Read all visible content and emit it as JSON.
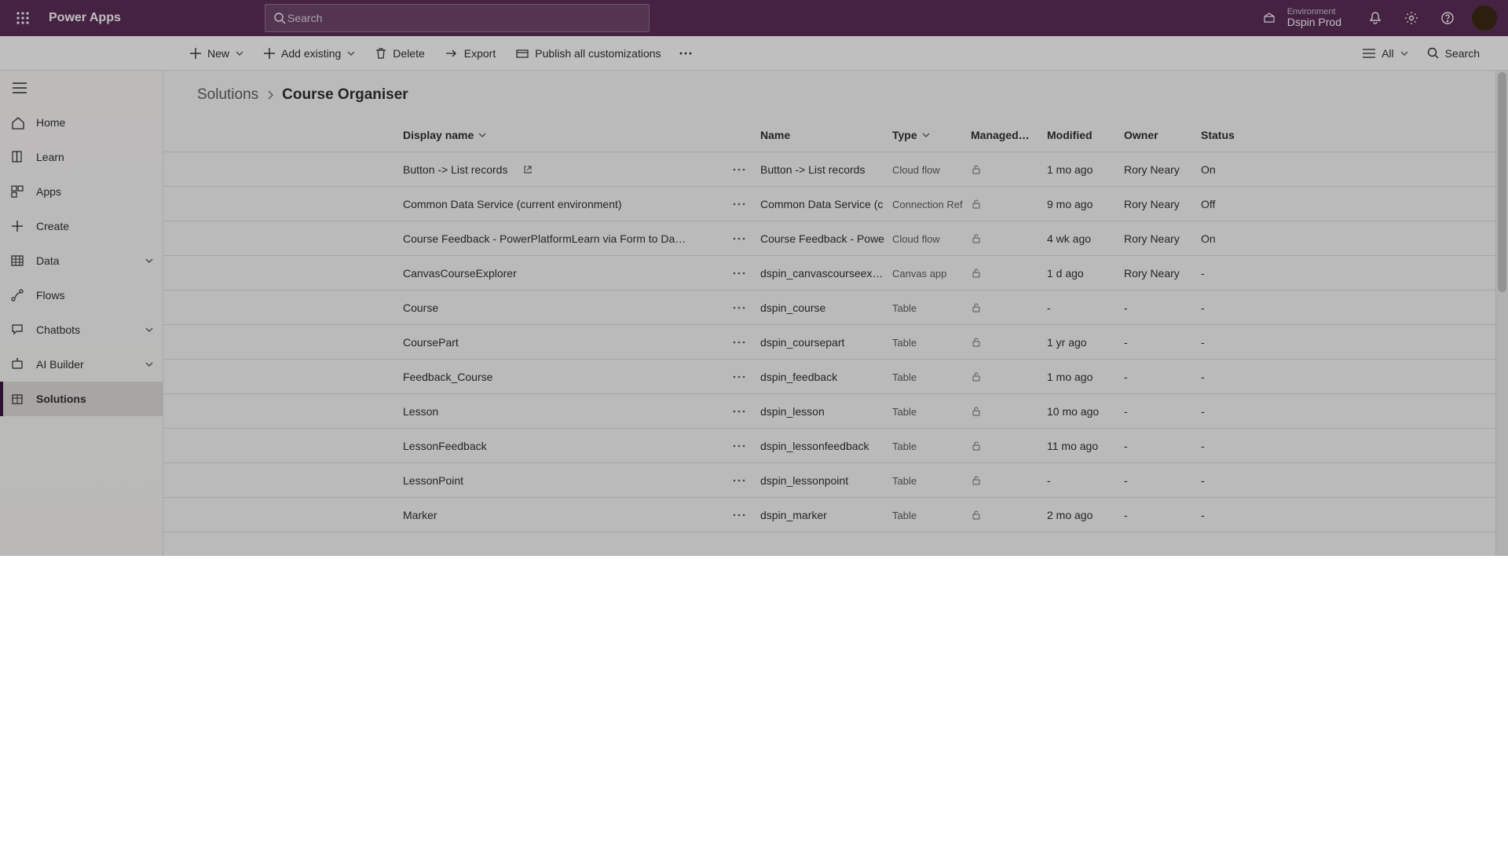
{
  "brand": "Power Apps",
  "search_placeholder": "Search",
  "environment": {
    "label": "Environment",
    "name": "Dspin Prod"
  },
  "cmdbar": {
    "new": "New",
    "add_existing": "Add existing",
    "delete": "Delete",
    "export": "Export",
    "publish": "Publish all customizations",
    "filter_all": "All",
    "search": "Search"
  },
  "sidebar": {
    "items": [
      {
        "label": "Home",
        "icon": "home"
      },
      {
        "label": "Learn",
        "icon": "book"
      },
      {
        "label": "Apps",
        "icon": "apps"
      },
      {
        "label": "Create",
        "icon": "plus"
      },
      {
        "label": "Data",
        "icon": "grid",
        "expandable": true
      },
      {
        "label": "Flows",
        "icon": "flow"
      },
      {
        "label": "Chatbots",
        "icon": "chat",
        "expandable": true
      },
      {
        "label": "AI Builder",
        "icon": "ai",
        "expandable": true
      },
      {
        "label": "Solutions",
        "icon": "package",
        "active": true
      }
    ]
  },
  "breadcrumbs": {
    "root": "Solutions",
    "current": "Course Organiser"
  },
  "columns": {
    "display_name": "Display name",
    "name": "Name",
    "type": "Type",
    "managed": "Managed…",
    "modified": "Modified",
    "owner": "Owner",
    "status": "Status"
  },
  "rows": [
    {
      "display": "Button -> List records",
      "ext": true,
      "name": "Button -> List records",
      "type": "Cloud flow",
      "managed": "lock",
      "modified": "1 mo ago",
      "owner": "Rory Neary",
      "status": "On"
    },
    {
      "display": "Common Data Service (current environment)",
      "name": "Common Data Service (c",
      "type": "Connection Ref",
      "managed": "lock",
      "modified": "9 mo ago",
      "owner": "Rory Neary",
      "status": "Off"
    },
    {
      "display": "Course Feedback - PowerPlatformLearn via Form to Da…",
      "name": "Course Feedback - Powe",
      "type": "Cloud flow",
      "managed": "lock",
      "modified": "4 wk ago",
      "owner": "Rory Neary",
      "status": "On"
    },
    {
      "display": "CanvasCourseExplorer",
      "name": "dspin_canvascourseexplo",
      "type": "Canvas app",
      "managed": "lock",
      "modified": "1 d ago",
      "owner": "Rory Neary",
      "status": "-"
    },
    {
      "display": "Course",
      "name": "dspin_course",
      "type": "Table",
      "managed": "lock",
      "modified": "-",
      "owner": "-",
      "status": "-"
    },
    {
      "display": "CoursePart",
      "name": "dspin_coursepart",
      "type": "Table",
      "managed": "lock",
      "modified": "1 yr ago",
      "owner": "-",
      "status": "-"
    },
    {
      "display": "Feedback_Course",
      "name": "dspin_feedback",
      "type": "Table",
      "managed": "lock",
      "modified": "1 mo ago",
      "owner": "-",
      "status": "-"
    },
    {
      "display": "Lesson",
      "name": "dspin_lesson",
      "type": "Table",
      "managed": "lock",
      "modified": "10 mo ago",
      "owner": "-",
      "status": "-"
    },
    {
      "display": "LessonFeedback",
      "name": "dspin_lessonfeedback",
      "type": "Table",
      "managed": "lock",
      "modified": "11 mo ago",
      "owner": "-",
      "status": "-"
    },
    {
      "display": "LessonPoint",
      "name": "dspin_lessonpoint",
      "type": "Table",
      "managed": "lock",
      "modified": "-",
      "owner": "-",
      "status": "-"
    },
    {
      "display": "Marker",
      "name": "dspin_marker",
      "type": "Table",
      "managed": "lock",
      "modified": "2 mo ago",
      "owner": "-",
      "status": "-"
    }
  ]
}
